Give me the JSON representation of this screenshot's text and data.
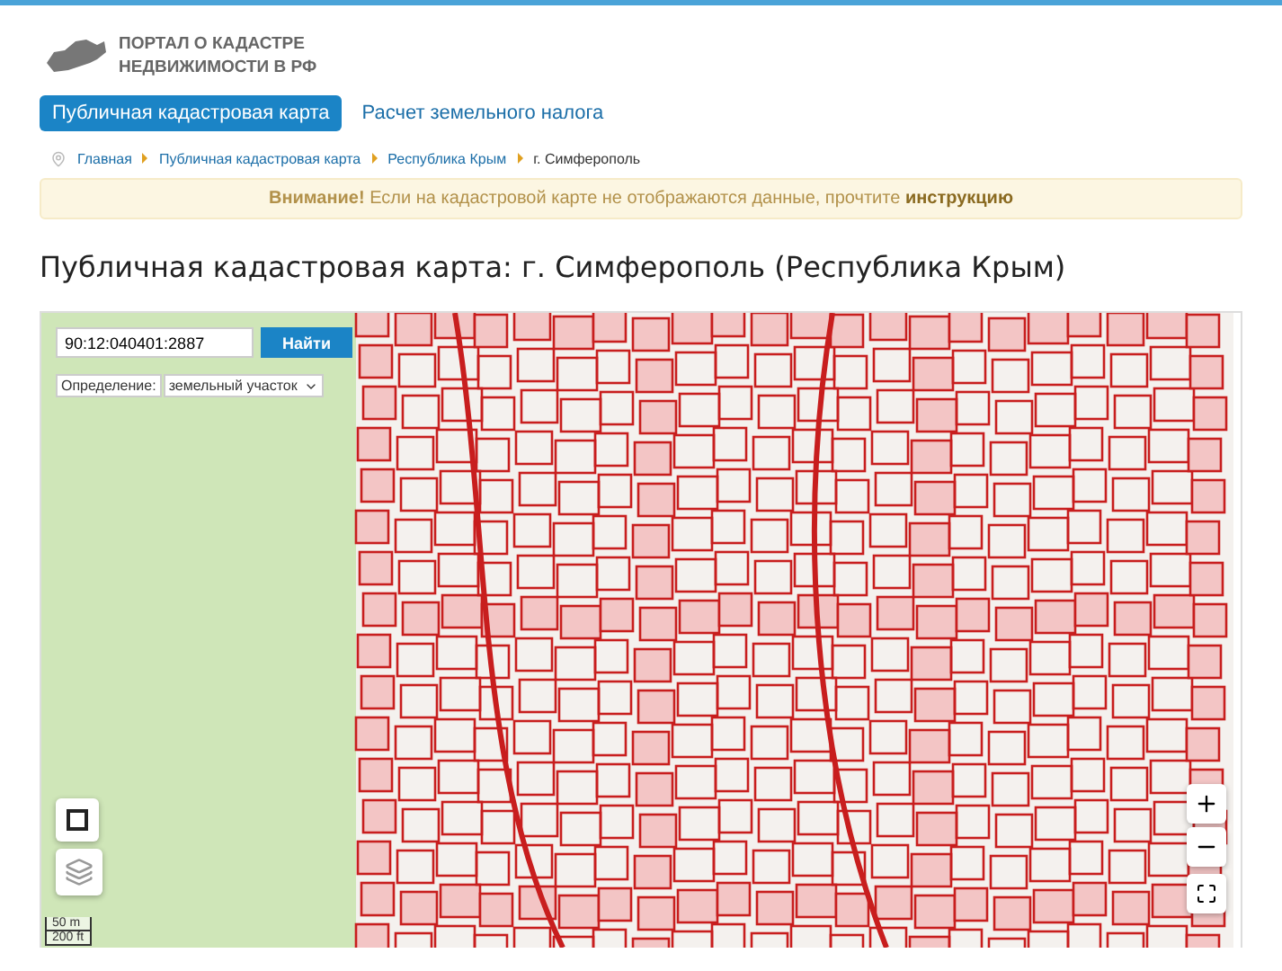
{
  "logo": {
    "line_1": "ПОРТАЛ О КАДАСТРЕ",
    "line_2": "НЕДВИЖИМОСТИ В РФ"
  },
  "nav": [
    {
      "label": "Публичная кадастровая карта",
      "selected": true
    },
    {
      "label": "Расчет земельного налога",
      "selected": false
    }
  ],
  "breadcrumbs": [
    {
      "label": "Главная",
      "kind": "link"
    },
    {
      "label": "Публичная кадастровая карта",
      "kind": "link"
    },
    {
      "label": "Республика Крым",
      "kind": "link"
    },
    {
      "label": "г. Симферополь",
      "kind": "current"
    }
  ],
  "alert": {
    "text": "**Внимание!** Если на кадастровой карте не отображаются данные, прочтите ",
    "link": "инструкцию"
  },
  "heading": "Публичная кадастровая карта: г. Симферополь (Республика Крым)",
  "map": {
    "search": {
      "value": "90:12:040401:2887",
      "button": "Найти"
    },
    "definition": {
      "label": "Определение:",
      "value": "земельный участок"
    },
    "scale": [
      "50 m",
      "200 ft"
    ]
  }
}
